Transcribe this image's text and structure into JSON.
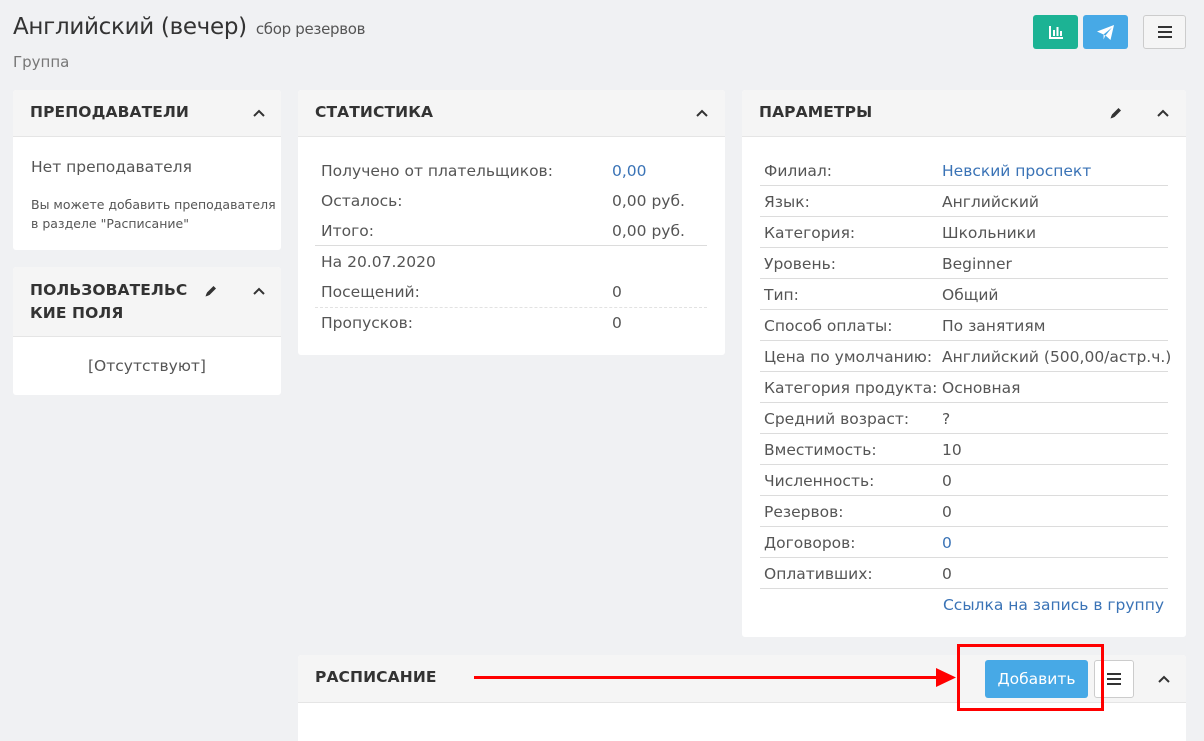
{
  "header": {
    "title": "Английский (вечер)",
    "subtitle": "сбор резервов",
    "kind": "Группа"
  },
  "toolbar": {
    "stats_icon": "bar-chart-icon",
    "send_icon": "paper-plane-icon",
    "menu_icon": "hamburger-icon"
  },
  "teachers": {
    "title": "ПРЕПОДАВАТЕЛИ",
    "empty": "Нет преподавателя",
    "hint_line1": "Вы можете добавить преподавателя",
    "hint_line2": "в разделе \"Расписание\""
  },
  "custom_fields": {
    "title_line1": "ПОЛЬЗОВАТЕЛЬС",
    "title_line2": "КИЕ ПОЛЯ",
    "empty": "[Отсутствуют]"
  },
  "statistics": {
    "title": "СТАТИСТИКА",
    "rows": [
      {
        "label": "Получено от плательщиков:",
        "value": "0,00"
      },
      {
        "label": "Осталось:",
        "value": "0,00 руб."
      },
      {
        "label": "Итого:",
        "value": "0,00 руб."
      }
    ],
    "date_label": "На 20.07.2020",
    "visits_label": "Посещений:",
    "visits_value": "0",
    "absences_label": "Пропусков:",
    "absences_value": "0"
  },
  "params": {
    "title": "ПАРАМЕТРЫ",
    "rows": [
      {
        "label": "Филиал:",
        "value": "Невский проспект"
      },
      {
        "label": "Язык:",
        "value": "Английский"
      },
      {
        "label": "Категория:",
        "value": "Школьники"
      },
      {
        "label": "Уровень:",
        "value": "Beginner"
      },
      {
        "label": "Тип:",
        "value": "Общий"
      },
      {
        "label": "Способ оплаты:",
        "value": "По занятиям"
      },
      {
        "label": "Цена по умолчанию:",
        "value": "Английский (500,00/астр.ч.)"
      },
      {
        "label": "Категория продукта:",
        "value": "Основная"
      },
      {
        "label": "Средний возраст:",
        "value": "?"
      },
      {
        "label": "Вместимость:",
        "value": "10"
      },
      {
        "label": "Численность:",
        "value": "0"
      },
      {
        "label": "Резервов:",
        "value": "0"
      },
      {
        "label": "Договоров:",
        "value": "0"
      },
      {
        "label": "Оплативших:",
        "value": "0"
      }
    ],
    "signup_link": "Ссылка на запись в группу"
  },
  "schedule": {
    "title": "РАСПИСАНИЕ",
    "add_label": "Добавить"
  },
  "colors": {
    "accent_green": "#1cb394",
    "accent_blue": "#47a9e6",
    "link": "#3a73b6",
    "annotation_red": "#ff0000"
  }
}
